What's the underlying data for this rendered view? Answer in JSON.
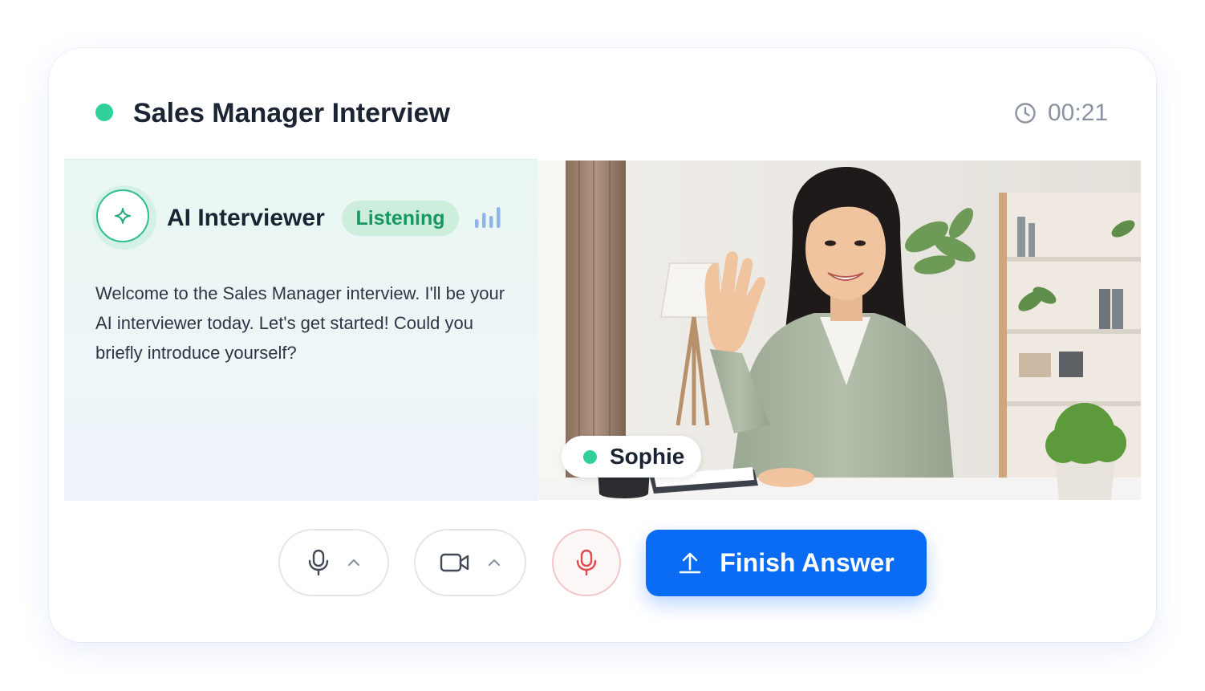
{
  "header": {
    "title": "Sales Manager Interview",
    "status_color": "#2fd09a",
    "timer": "00:21",
    "timer_icon": "clock-icon"
  },
  "ai_panel": {
    "name": "AI Interviewer",
    "status": "Listening",
    "avatar_icon": "sparkle-icon",
    "level_icon": "audio-level-icon",
    "message": "Welcome to the Sales Manager interview. I'll be your AI interviewer today. Let's get started! Could you briefly introduce yourself?"
  },
  "video": {
    "participant_name": "Sophie",
    "online_color": "#2fd09a"
  },
  "controls": {
    "mic_icon": "microphone-icon",
    "camera_icon": "video-camera-icon",
    "mute_icon": "microphone-red-icon",
    "finish_label": "Finish Answer",
    "finish_icon": "upload-icon",
    "accent": "#0a6cf5"
  }
}
